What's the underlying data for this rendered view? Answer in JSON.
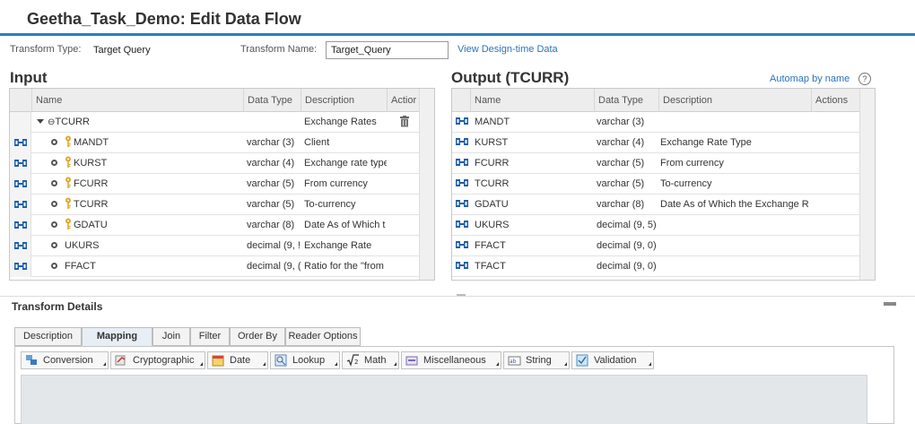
{
  "header": {
    "title": "Geetha_Task_Demo: Edit Data Flow"
  },
  "props": {
    "transform_type_label": "Transform Type:",
    "transform_type_value": "Target Query",
    "transform_name_label": "Transform Name:",
    "transform_name_value": "Target_Query",
    "design_time_link": "View Design-time Data"
  },
  "input": {
    "title": "Input",
    "headers": {
      "name": "Name",
      "datatype": "Data Type",
      "description": "Description",
      "actions": "Actior"
    },
    "parent": {
      "name": "TCURR",
      "description": "Exchange Rates"
    },
    "rows": [
      {
        "name": "MANDT",
        "key": true,
        "datatype": "varchar (3)",
        "description": "Client"
      },
      {
        "name": "KURST",
        "key": true,
        "datatype": "varchar (4)",
        "description": "Exchange rate type"
      },
      {
        "name": "FCURR",
        "key": true,
        "datatype": "varchar (5)",
        "description": "From currency"
      },
      {
        "name": "TCURR",
        "key": true,
        "datatype": "varchar (5)",
        "description": "To-currency"
      },
      {
        "name": "GDATU",
        "key": true,
        "datatype": "varchar (8)",
        "description": "Date As of Which t"
      },
      {
        "name": "UKURS",
        "key": false,
        "datatype": "decimal (9, !",
        "description": "Exchange Rate"
      },
      {
        "name": "FFACT",
        "key": false,
        "datatype": "decimal (9, (",
        "description": "Ratio for the \"from"
      }
    ]
  },
  "output": {
    "title": "Output (TCURR)",
    "automap_link": "Automap by name",
    "help_label": "?",
    "headers": {
      "name": "Name",
      "datatype": "Data Type",
      "description": "Description",
      "actions": "Actions"
    },
    "rows": [
      {
        "name": "MANDT",
        "datatype": "varchar (3)",
        "description": ""
      },
      {
        "name": "KURST",
        "datatype": "varchar (4)",
        "description": "Exchange Rate Type"
      },
      {
        "name": "FCURR",
        "datatype": "varchar (5)",
        "description": "From currency"
      },
      {
        "name": "TCURR",
        "datatype": "varchar (5)",
        "description": "To-currency"
      },
      {
        "name": "GDATU",
        "datatype": "varchar (8)",
        "description": "Date As of Which the Exchange R"
      },
      {
        "name": "UKURS",
        "datatype": "decimal (9, 5)",
        "description": ""
      },
      {
        "name": "FFACT",
        "datatype": "decimal (9, 0)",
        "description": ""
      },
      {
        "name": "TFACT",
        "datatype": "decimal (9, 0)",
        "description": ""
      }
    ]
  },
  "details": {
    "title": "Transform Details",
    "tabs": [
      "Description",
      "Mapping",
      "Join",
      "Filter",
      "Order By",
      "Reader Options"
    ],
    "active_tab": "Mapping",
    "toolbar": [
      "Conversion",
      "Cryptographic",
      "Date",
      "Lookup",
      "Math",
      "Miscellaneous",
      "String",
      "Validation"
    ]
  },
  "colors": {
    "accent": "#2a7fc1",
    "link": "#2a73b8",
    "connector": "#1f5fa8",
    "key": "#e0a82e"
  }
}
